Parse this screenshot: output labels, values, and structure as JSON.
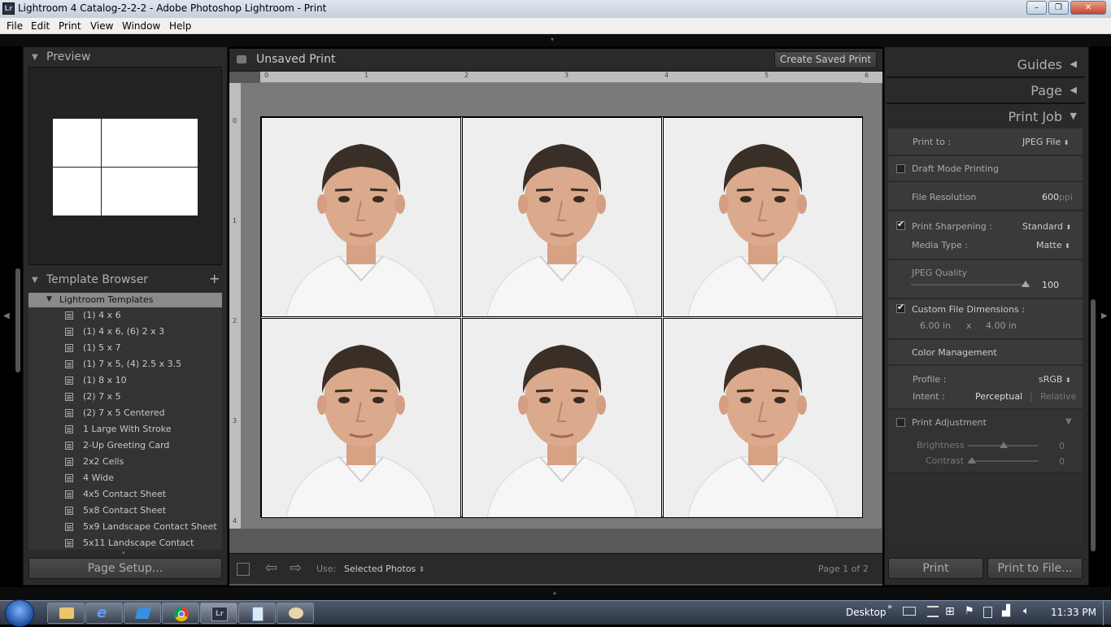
{
  "window": {
    "title": "Lightroom 4 Catalog-2-2-2 - Adobe Photoshop Lightroom - Print",
    "app_badge": "Lr"
  },
  "menu": [
    "File",
    "Edit",
    "Print",
    "View",
    "Window",
    "Help"
  ],
  "left": {
    "preview_label": "Preview",
    "template_browser_label": "Template Browser",
    "add_glyph": "+",
    "folder": "Lightroom Templates",
    "templates": [
      "(1) 4 x 6",
      "(1) 4 x 6, (6) 2 x 3",
      "(1) 5 x 7",
      "(1) 7 x 5, (4) 2.5 x 3.5",
      "(1) 8 x 10",
      "(2) 7 x 5",
      "(2) 7 x 5 Centered",
      "1 Large With Stroke",
      "2-Up Greeting Card",
      "2x2 Cells",
      "4 Wide",
      "4x5 Contact Sheet",
      "5x8 Contact Sheet",
      "5x9 Landscape Contact Sheet",
      "5x11 Landscape Contact Sheet"
    ],
    "page_setup": "Page Setup..."
  },
  "center": {
    "title": "Unsaved Print",
    "create_saved": "Create Saved Print",
    "h_ruler_labels": [
      "0",
      "1",
      "2",
      "3",
      "4",
      "5",
      "6"
    ],
    "v_ruler_labels": [
      "0",
      "1",
      "2",
      "3",
      "4"
    ],
    "use_label": "Use:",
    "use_value": "Selected Photos",
    "page_info": "Page 1 of 2"
  },
  "right": {
    "guides": "Guides",
    "page": "Page",
    "print_job": "Print Job",
    "print_to_label": "Print to :",
    "print_to_value": "JPEG File",
    "draft_mode": "Draft Mode Printing",
    "draft_checked": false,
    "file_resolution_label": "File Resolution",
    "file_resolution_value": "600",
    "file_resolution_unit": "ppi",
    "sharpening_label": "Print Sharpening :",
    "sharpening_value": "Standard",
    "sharpening_checked": true,
    "media_type_label": "Media Type :",
    "media_type_value": "Matte",
    "jpeg_quality_label": "JPEG Quality",
    "jpeg_quality_value": "100",
    "custom_dims_label": "Custom File Dimensions :",
    "custom_dims_checked": true,
    "dim_w": "6.00",
    "dim_h": "4.00",
    "dim_unit": "in",
    "dim_x": "x",
    "color_mgmt": "Color Management",
    "profile_label": "Profile :",
    "profile_value": "sRGB",
    "intent_label": "Intent :",
    "intent_perceptual": "Perceptual",
    "intent_sep": "|",
    "intent_relative": "Relative",
    "print_adjust": "Print Adjustment",
    "print_adjust_checked": false,
    "brightness_label": "Brightness",
    "brightness_value": "0",
    "contrast_label": "Contrast",
    "contrast_value": "0",
    "print_btn": "Print",
    "print_file_btn": "Print to File..."
  },
  "taskbar": {
    "desktop": "Desktop",
    "time": "11:33 PM"
  },
  "colors": {
    "panel": "#2a2a2a",
    "canvas": "#595959",
    "paper": "#f4f4f4"
  }
}
